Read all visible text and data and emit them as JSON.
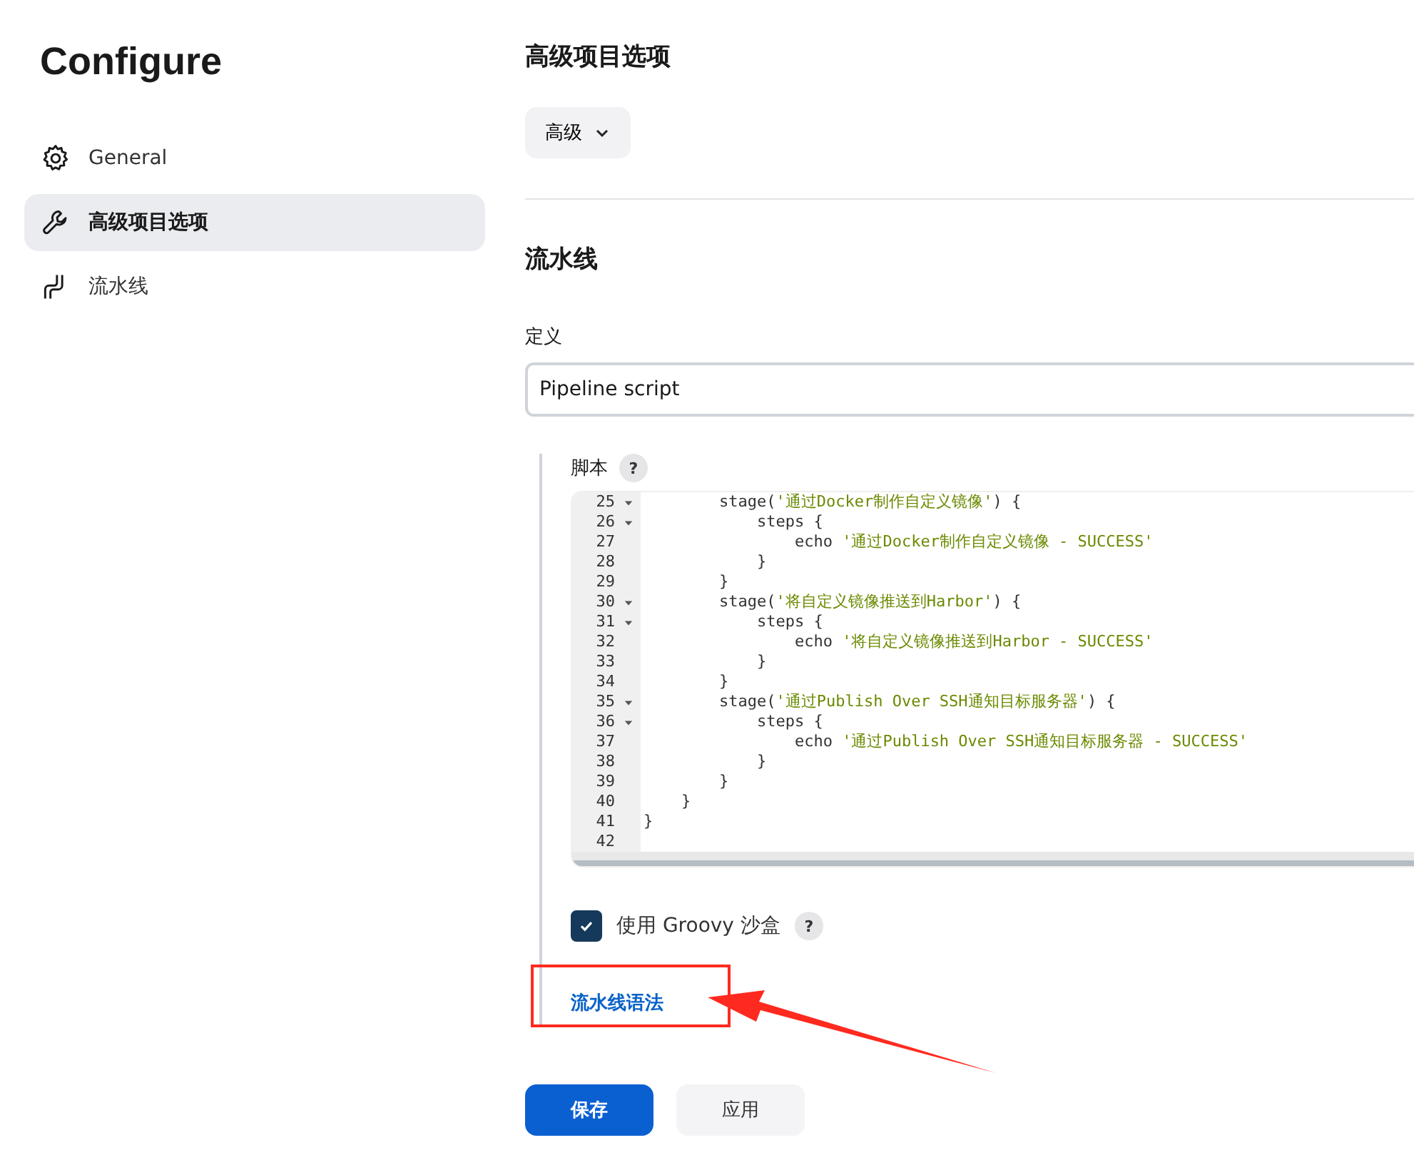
{
  "sidebar": {
    "title": "Configure",
    "items": [
      {
        "label": "General",
        "selected": false
      },
      {
        "label": "高级项目选项",
        "selected": true
      },
      {
        "label": "流水线",
        "selected": false
      }
    ]
  },
  "advanced": {
    "title": "高级项目选项",
    "dropdown": "高级"
  },
  "pipeline": {
    "title": "流水线",
    "definition_label": "定义",
    "definition_value": "Pipeline script",
    "script_label": "脚本",
    "help": "?",
    "lines": [
      {
        "number": "25",
        "foldable": true,
        "tokens": [
          {
            "kind": "plain",
            "text": "        stage("
          },
          {
            "kind": "string",
            "text": "'通过Docker制作自定义镜像'"
          },
          {
            "kind": "plain",
            "text": ") {"
          }
        ]
      },
      {
        "number": "26",
        "foldable": true,
        "tokens": [
          {
            "kind": "plain",
            "text": "            steps {"
          }
        ]
      },
      {
        "number": "27",
        "foldable": false,
        "tokens": [
          {
            "kind": "plain",
            "text": "                echo "
          },
          {
            "kind": "string",
            "text": "'通过Docker制作自定义镜像 - SUCCESS'"
          }
        ]
      },
      {
        "number": "28",
        "foldable": false,
        "tokens": [
          {
            "kind": "plain",
            "text": "            }"
          }
        ]
      },
      {
        "number": "29",
        "foldable": false,
        "tokens": [
          {
            "kind": "plain",
            "text": "        }"
          }
        ]
      },
      {
        "number": "30",
        "foldable": true,
        "tokens": [
          {
            "kind": "plain",
            "text": "        stage("
          },
          {
            "kind": "string",
            "text": "'将自定义镜像推送到Harbor'"
          },
          {
            "kind": "plain",
            "text": ") {"
          }
        ]
      },
      {
        "number": "31",
        "foldable": true,
        "tokens": [
          {
            "kind": "plain",
            "text": "            steps {"
          }
        ]
      },
      {
        "number": "32",
        "foldable": false,
        "tokens": [
          {
            "kind": "plain",
            "text": "                echo "
          },
          {
            "kind": "string",
            "text": "'将自定义镜像推送到Harbor - SUCCESS'"
          }
        ]
      },
      {
        "number": "33",
        "foldable": false,
        "tokens": [
          {
            "kind": "plain",
            "text": "            }"
          }
        ]
      },
      {
        "number": "34",
        "foldable": false,
        "tokens": [
          {
            "kind": "plain",
            "text": "        }"
          }
        ]
      },
      {
        "number": "35",
        "foldable": true,
        "tokens": [
          {
            "kind": "plain",
            "text": "        stage("
          },
          {
            "kind": "string",
            "text": "'通过Publish Over SSH通知目标服务器'"
          },
          {
            "kind": "plain",
            "text": ") {"
          }
        ]
      },
      {
        "number": "36",
        "foldable": true,
        "tokens": [
          {
            "kind": "plain",
            "text": "            steps {"
          }
        ]
      },
      {
        "number": "37",
        "foldable": false,
        "tokens": [
          {
            "kind": "plain",
            "text": "                echo "
          },
          {
            "kind": "string",
            "text": "'通过Publish Over SSH通知目标服务器 - SUCCESS'"
          }
        ]
      },
      {
        "number": "38",
        "foldable": false,
        "tokens": [
          {
            "kind": "plain",
            "text": "            }"
          }
        ]
      },
      {
        "number": "39",
        "foldable": false,
        "tokens": [
          {
            "kind": "plain",
            "text": "        }"
          }
        ]
      },
      {
        "number": "40",
        "foldable": false,
        "tokens": [
          {
            "kind": "plain",
            "text": "    }"
          }
        ]
      },
      {
        "number": "41",
        "foldable": false,
        "tokens": [
          {
            "kind": "plain",
            "text": "}"
          }
        ]
      },
      {
        "number": "42",
        "foldable": false
      }
    ],
    "sandbox": {
      "label": "使用 Groovy 沙盒",
      "checked": true,
      "help": "?"
    },
    "syntax_link": "流水线语法"
  },
  "buttons": [
    {
      "label": "保存",
      "kind": "primary"
    },
    {
      "label": "应用",
      "kind": "secondary"
    }
  ]
}
